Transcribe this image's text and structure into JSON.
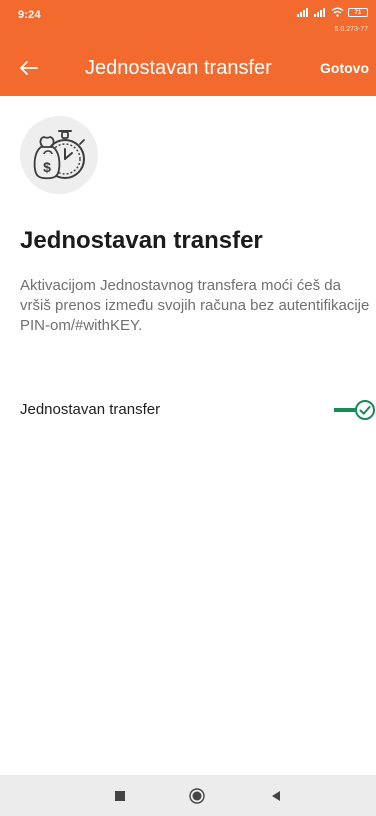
{
  "status_bar": {
    "time": "9:24",
    "battery": "71",
    "version": "5.0.273-77"
  },
  "toolbar": {
    "title": "Jednostavan transfer",
    "done_label": "Gotovo",
    "accent_color": "#f26a2e"
  },
  "content": {
    "icon": "money-timer-icon",
    "heading": "Jednostavan transfer",
    "description": "Aktivacijom Jednostavnog transfera moći ćeš da vršiš prenos između svojih računa bez autentifikacije PIN-om/#withKEY."
  },
  "setting": {
    "label": "Jednostavan transfer",
    "enabled": true,
    "toggle_color": "#1a8a5a"
  },
  "navigation": {
    "recent": "recent-apps-icon",
    "home": "home-icon",
    "back": "back-icon"
  }
}
